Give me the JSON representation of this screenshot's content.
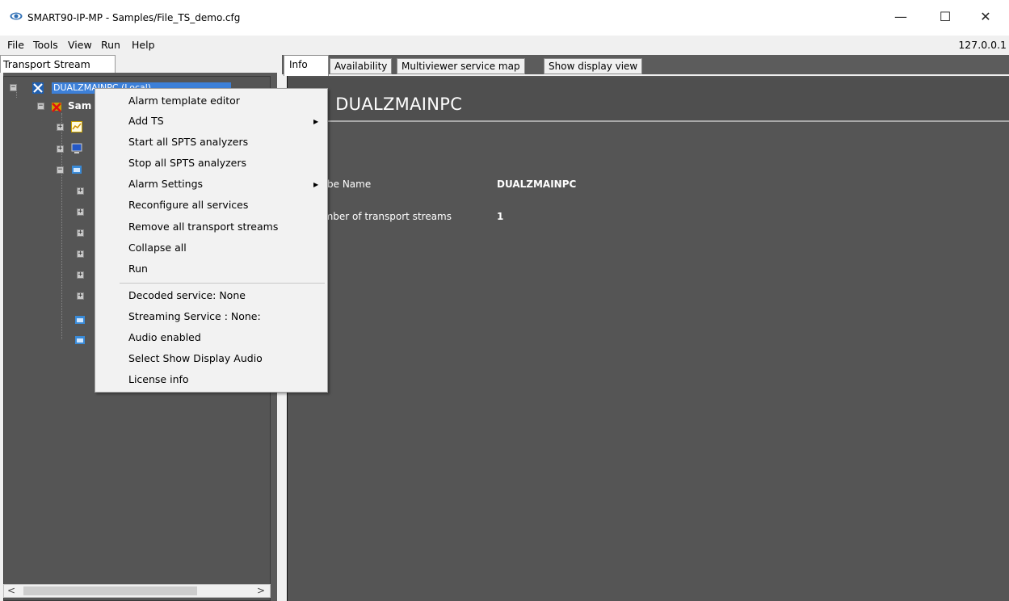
{
  "window": {
    "title": "SMART90-IP-MP - Samples/File_TS_demo.cfg",
    "minimize_glyph": "—",
    "maximize_glyph": "☐",
    "close_glyph": "✕"
  },
  "menubar": {
    "items": [
      "File",
      "Tools",
      "View",
      "Run",
      "Help"
    ],
    "ip": "127.0.0.1"
  },
  "left_panel": {
    "tab_label": "Transport Stream",
    "tree": {
      "root_label": "DUALZMAINPC (Local)",
      "samples_label": "Sam"
    },
    "scroll_left": "<",
    "scroll_right": ">"
  },
  "tabs": [
    "Info",
    "Availability",
    "Multiviewer service map",
    "Show display view"
  ],
  "content": {
    "title": "fo: DUALZMAINPC",
    "fields": [
      {
        "label": "robe Name",
        "value": "DUALZMAINPC"
      },
      {
        "label": "umber of transport streams",
        "value": "1"
      }
    ]
  },
  "context_menu": {
    "items": [
      {
        "label": "Alarm template editor",
        "submenu": false
      },
      {
        "label": "Add TS",
        "submenu": true
      },
      {
        "label": "Start all SPTS analyzers",
        "submenu": false
      },
      {
        "label": "Stop all SPTS analyzers",
        "submenu": false
      },
      {
        "label": "Alarm Settings",
        "submenu": true
      },
      {
        "label": "Reconfigure all services",
        "submenu": false
      },
      {
        "label": "Remove all transport streams",
        "submenu": false
      },
      {
        "label": "Collapse all",
        "submenu": false
      },
      {
        "label": "Run",
        "submenu": false
      },
      {
        "label": "Decoded service: None",
        "submenu": false
      },
      {
        "label": "Streaming Service : None:",
        "submenu": false
      },
      {
        "label": "Audio enabled",
        "submenu": false
      },
      {
        "label": "Select Show Display Audio",
        "submenu": false
      },
      {
        "label": "License info",
        "submenu": false
      }
    ],
    "submenu_glyph": "▶"
  },
  "icons": {
    "app": "eye-icon",
    "tree_root": "tools-icon",
    "samples": "error-folder-icon",
    "chart": "chart-icon",
    "monitor": "monitor-icon",
    "stream": "stream-icon"
  },
  "colors": {
    "selection": "#3d80d8",
    "panel_bg": "#555555"
  }
}
